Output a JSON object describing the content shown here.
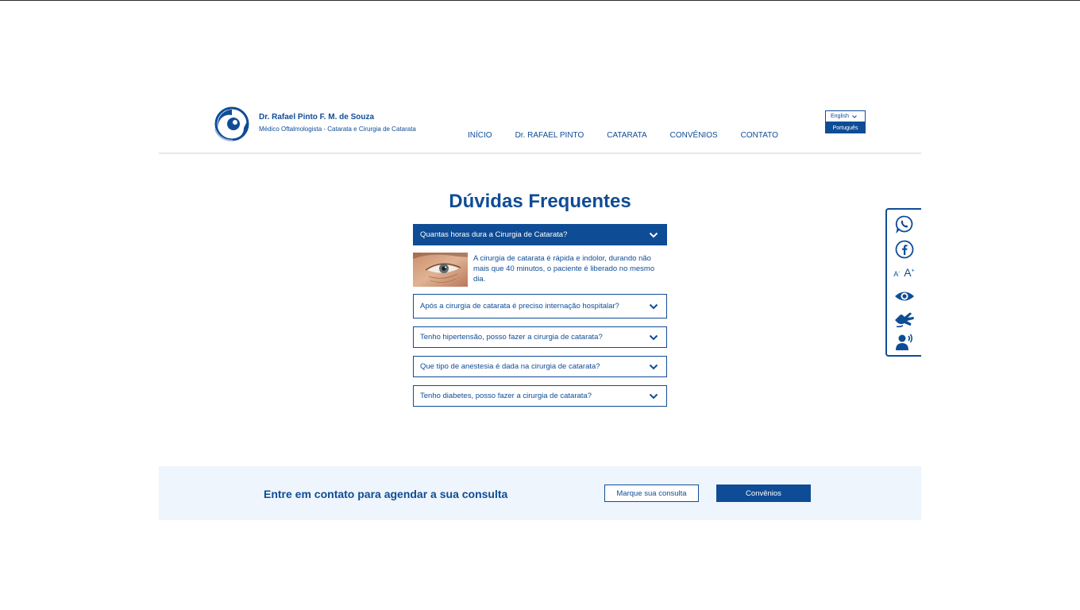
{
  "header": {
    "brand_name": "Dr. Rafael Pinto F. M. de Souza",
    "brand_subtitle": "Médico Oftalmologista - Catarata e Cirurgia de Catarata",
    "nav": [
      "INÍCIO",
      "Dr. RAFAEL PINTO",
      "CATARATA",
      "CONVÊNIOS",
      "CONTATO"
    ],
    "language": {
      "selected": "English",
      "options": [
        "Português"
      ]
    }
  },
  "faq": {
    "title": "Dúvidas Frequentes",
    "items": [
      {
        "question": "Quantas horas dura a Cirurgia de Catarata?",
        "open": true,
        "answer": "A cirurgia de catarata é rápida e indolor, durando não mais que 40 minutos, o paciente é liberado no mesmo dia."
      },
      {
        "question": "Após a cirurgia de catarata é preciso internação hospitalar?",
        "open": false
      },
      {
        "question": "Tenho hipertensão, posso fazer a cirurgia de catarata?",
        "open": false
      },
      {
        "question": "Que tipo de anestesia é dada na cirurgia de catarata?",
        "open": false
      },
      {
        "question": "Tenho diabetes, posso fazer a cirurgia de catarata?",
        "open": false
      }
    ]
  },
  "accessibility": {
    "tools": [
      "whatsapp-icon",
      "facebook-icon",
      "font-size-icon",
      "low-vision-icon",
      "sign-language-icon",
      "screen-reader-icon"
    ],
    "font_decrease": "A",
    "font_increase": "A"
  },
  "cta": {
    "text": "Entre em contato para agendar a sua consulta",
    "button_schedule": "Marque sua consulta",
    "button_insurance": "Convênios"
  },
  "colors": {
    "primary": "#0f4c96",
    "cta_background": "#eef5fc"
  }
}
